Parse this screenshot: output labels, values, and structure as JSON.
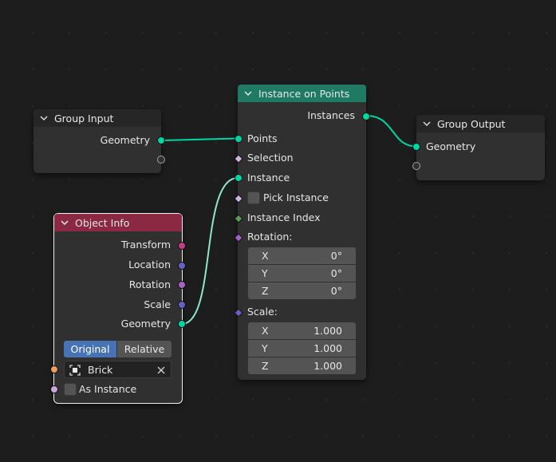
{
  "nodes": {
    "group_input": {
      "title": "Group Input",
      "outputs": [
        "Geometry"
      ]
    },
    "instance_on_points": {
      "title": "Instance on Points",
      "header_color": "#1e7a62",
      "output": "Instances",
      "inputs": {
        "points": "Points",
        "selection": "Selection",
        "instance": "Instance",
        "pick_instance": "Pick Instance",
        "instance_index": "Instance Index",
        "rotation": "Rotation:",
        "scale": "Scale:"
      },
      "rotation": [
        {
          "axis": "X",
          "value": "0°"
        },
        {
          "axis": "Y",
          "value": "0°"
        },
        {
          "axis": "Z",
          "value": "0°"
        }
      ],
      "scale": [
        {
          "axis": "X",
          "value": "1.000"
        },
        {
          "axis": "Y",
          "value": "1.000"
        },
        {
          "axis": "Z",
          "value": "1.000"
        }
      ]
    },
    "group_output": {
      "title": "Group Output",
      "inputs": [
        "Geometry"
      ]
    },
    "object_info": {
      "title": "Object Info",
      "header_color": "#8b2943",
      "outputs": [
        "Transform",
        "Location",
        "Rotation",
        "Scale",
        "Geometry"
      ],
      "mode_options": [
        "Original",
        "Relative"
      ],
      "mode_selected": "Original",
      "object": "Brick",
      "as_instance_label": "As Instance"
    }
  },
  "colors": {
    "geometry_socket": "#00d6a3",
    "matrix_socket": "#c53c86",
    "vector_socket": "#6363c7",
    "rotation_socket": "#a663c7",
    "bool_socket": "#ccA6d6",
    "int_socket": "#5a9a5a",
    "object_socket": "#ed9e5c",
    "link": "#7fe0c6"
  }
}
